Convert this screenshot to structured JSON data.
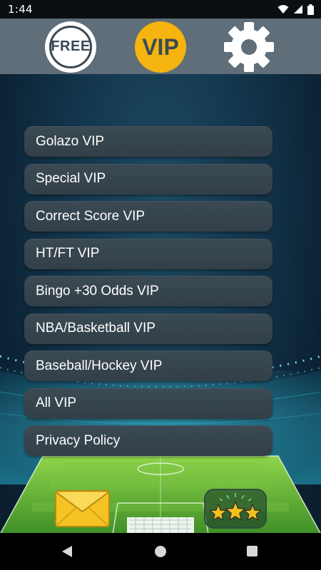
{
  "status_bar": {
    "time": "1:44",
    "icons": [
      "wifi-icon",
      "signal-icon",
      "battery-icon"
    ]
  },
  "top_bar": {
    "free_label": "FREE",
    "vip_label": "VIP",
    "settings_icon": "gear-icon"
  },
  "menu": {
    "items": [
      {
        "label": "Golazo VIP"
      },
      {
        "label": "Special VIP"
      },
      {
        "label": "Correct Score VIP"
      },
      {
        "label": "HT/FT VIP"
      },
      {
        "label": "Bingo +30 Odds VIP"
      },
      {
        "label": "NBA/Basketball VIP"
      },
      {
        "label": "Baseball/Hockey VIP"
      },
      {
        "label": "All VIP"
      },
      {
        "label": "Privacy Policy"
      }
    ]
  },
  "bottom": {
    "mail_icon": "envelope-icon",
    "rate_icon": "stars-icon"
  },
  "nav_bar": {
    "back_icon": "back-triangle-icon",
    "home_icon": "home-circle-icon",
    "recents_icon": "recents-square-icon"
  },
  "colors": {
    "top_bar": "#5f6e79",
    "vip_accent": "#f5b40f",
    "menu_button": "#37454e",
    "pitch": "#5fae33"
  }
}
